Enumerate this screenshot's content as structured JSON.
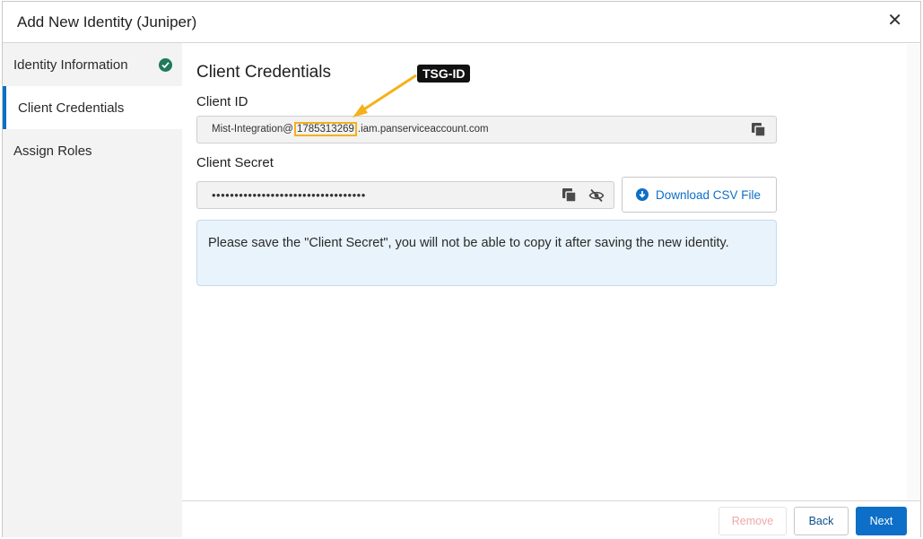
{
  "dialog": {
    "title": "Add New Identity (Juniper)",
    "close_glyph": "✕"
  },
  "sidebar": {
    "items": [
      {
        "label": "Identity Information",
        "completed": true,
        "active": false
      },
      {
        "label": "Client Credentials",
        "completed": false,
        "active": true
      },
      {
        "label": "Assign Roles",
        "completed": false,
        "active": false
      }
    ]
  },
  "main": {
    "section_title": "Client Credentials",
    "client_id": {
      "label": "Client ID",
      "prefix": "Mist-Integration@",
      "tsg_id": "1785313269",
      "suffix": ".iam.panserviceaccount.com",
      "copy_icon": "copy-icon"
    },
    "client_secret": {
      "label": "Client Secret",
      "masked_value": "••••••••••••••••••••••••••••••••••",
      "copy_icon": "copy-icon",
      "visibility_icon": "eye-off-icon"
    },
    "download_button": {
      "label": "Download CSV File",
      "icon": "download-circle-icon"
    },
    "info_message": "Please save the \"Client Secret\", you will not be able to copy it after saving the new identity."
  },
  "annotation": {
    "tag": "TSG-ID",
    "color": "#f5b11b"
  },
  "footer": {
    "remove_label": "Remove",
    "back_label": "Back",
    "next_label": "Next"
  },
  "colors": {
    "accent": "#0d6fc7",
    "success": "#207a5a",
    "info_bg": "#e9f3fb"
  }
}
